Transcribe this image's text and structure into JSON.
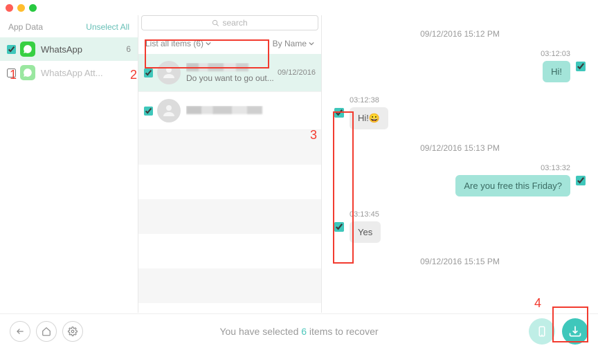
{
  "search": {
    "placeholder": "search"
  },
  "sidebar": {
    "header": "App Data",
    "unselect": "Unselect All",
    "items": [
      {
        "label": "WhatsApp",
        "count": "6",
        "selected": true
      },
      {
        "label": "WhatsApp Att...",
        "count": "",
        "selected": false
      }
    ]
  },
  "list_header": {
    "all": "List all items (6)",
    "sort": "By Name"
  },
  "conversations": [
    {
      "preview": "Do you want to go out...",
      "date": "09/12/2016",
      "selected": true
    },
    {
      "preview": "",
      "date": "",
      "selected": false
    }
  ],
  "chat": {
    "groups": [
      {
        "stamp": "09/12/2016 15:12 PM",
        "messages": [
          {
            "side": "right",
            "time": "03:12:03",
            "text": "Hi!"
          },
          {
            "side": "left",
            "time": "03:12:38",
            "text": "Hi!😀"
          }
        ]
      },
      {
        "stamp": "09/12/2016 15:13 PM",
        "messages": [
          {
            "side": "right",
            "time": "03:13:32",
            "text": "Are you free this Friday?"
          },
          {
            "side": "left",
            "time": "03:13:45",
            "text": "Yes"
          }
        ]
      },
      {
        "stamp": "09/12/2016 15:15 PM",
        "messages": []
      }
    ]
  },
  "footer": {
    "pre": "You have selected ",
    "count": "6",
    "post": " items to recover"
  },
  "annotations": {
    "n1": "1",
    "n2": "2",
    "n3": "3",
    "n4": "4"
  }
}
